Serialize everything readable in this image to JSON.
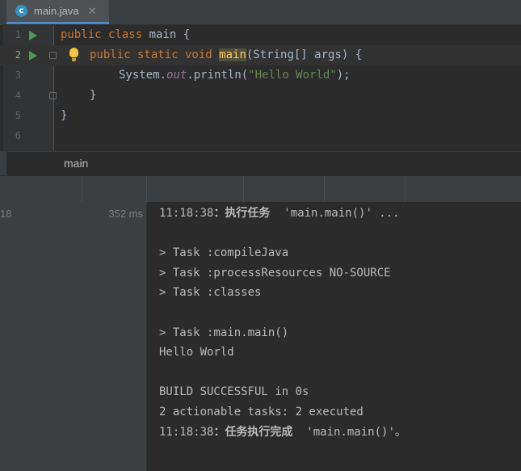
{
  "tab": {
    "filename": "main.java",
    "icon": "java-class-icon",
    "close": "✕"
  },
  "editor": {
    "line_numbers": [
      "1",
      "2",
      "3",
      "4",
      "5",
      "6"
    ],
    "lines": [
      {
        "t1": "public class ",
        "t2": "main",
        "t3": " {"
      },
      {
        "t1": "public static void ",
        "t2": "main",
        "t3": "(String[] args) {"
      },
      {
        "t1": "System.",
        "t2": "out",
        "t3": ".println(",
        "t4": "\"Hello World\"",
        "t5": ");"
      },
      {
        "t1": "}"
      },
      {
        "t1": "}"
      },
      {
        "t1": ""
      }
    ]
  },
  "breadcrumb": "main",
  "run_tree": {
    "id": "18",
    "duration": "352 ms"
  },
  "console": [
    {
      "time": "11:18:38",
      "sep": "：",
      "label": "执行任务",
      "rest": "  'main.main()' ..."
    },
    "",
    "> Task :compileJava",
    "> Task :processResources NO-SOURCE",
    "> Task :classes",
    "",
    "> Task :main.main()",
    "Hello World",
    "",
    "BUILD SUCCESSFUL in 0s",
    "2 actionable tasks: 2 executed",
    {
      "time": "11:18:38",
      "sep": "：",
      "label": "任务执行完成",
      "rest": "  'main.main()'。"
    }
  ],
  "colors": {
    "keyword": "#cc7832",
    "method": "#ffc66d",
    "string": "#6a8759",
    "field": "#9876aa",
    "run_arrow": "#499c54"
  }
}
